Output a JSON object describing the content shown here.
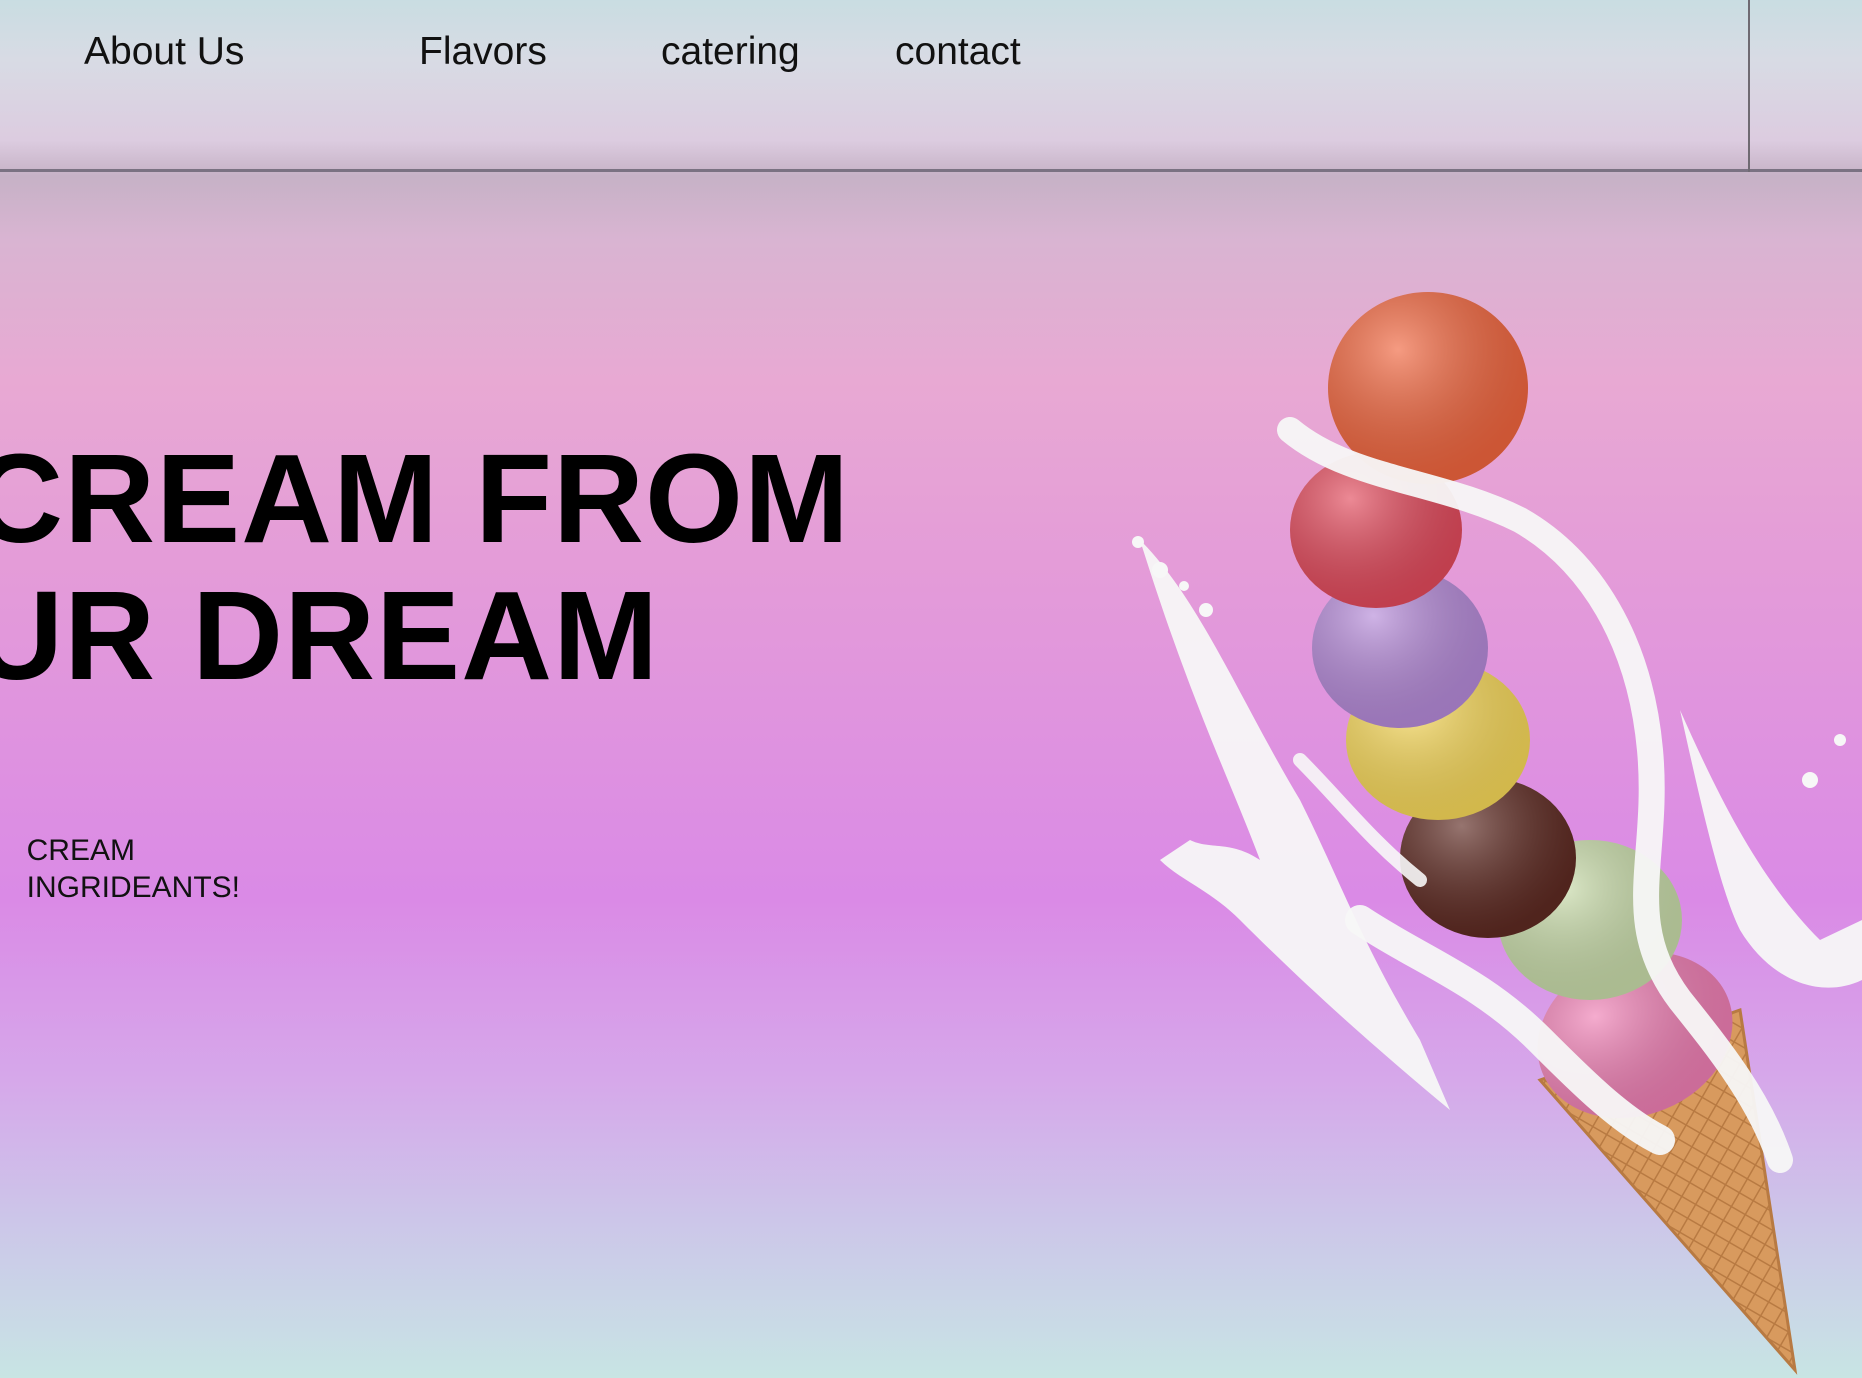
{
  "nav": {
    "links": [
      {
        "label": "About Us"
      },
      {
        "label": "Flavors"
      },
      {
        "label": "catering"
      },
      {
        "label": "contact"
      }
    ]
  },
  "hero": {
    "title_line1": "CREAM FROM",
    "title_line2": "UR DREAM",
    "sub_line1": "CREAM",
    "sub_line2": "INGRIDEANTS!"
  },
  "image": {
    "icon": "ice-cream-cone-icon",
    "scoop_colors": [
      "#f0653e",
      "#e24a5c",
      "#b58ad8",
      "#f7d85a",
      "#5e2a22",
      "#c9dcaa",
      "#ef7fb4"
    ],
    "cone_color": "#d89a5e",
    "milk_color": "#f7f7f7"
  },
  "colors": {
    "text": "#000000",
    "nav_border": "#7a7282"
  }
}
